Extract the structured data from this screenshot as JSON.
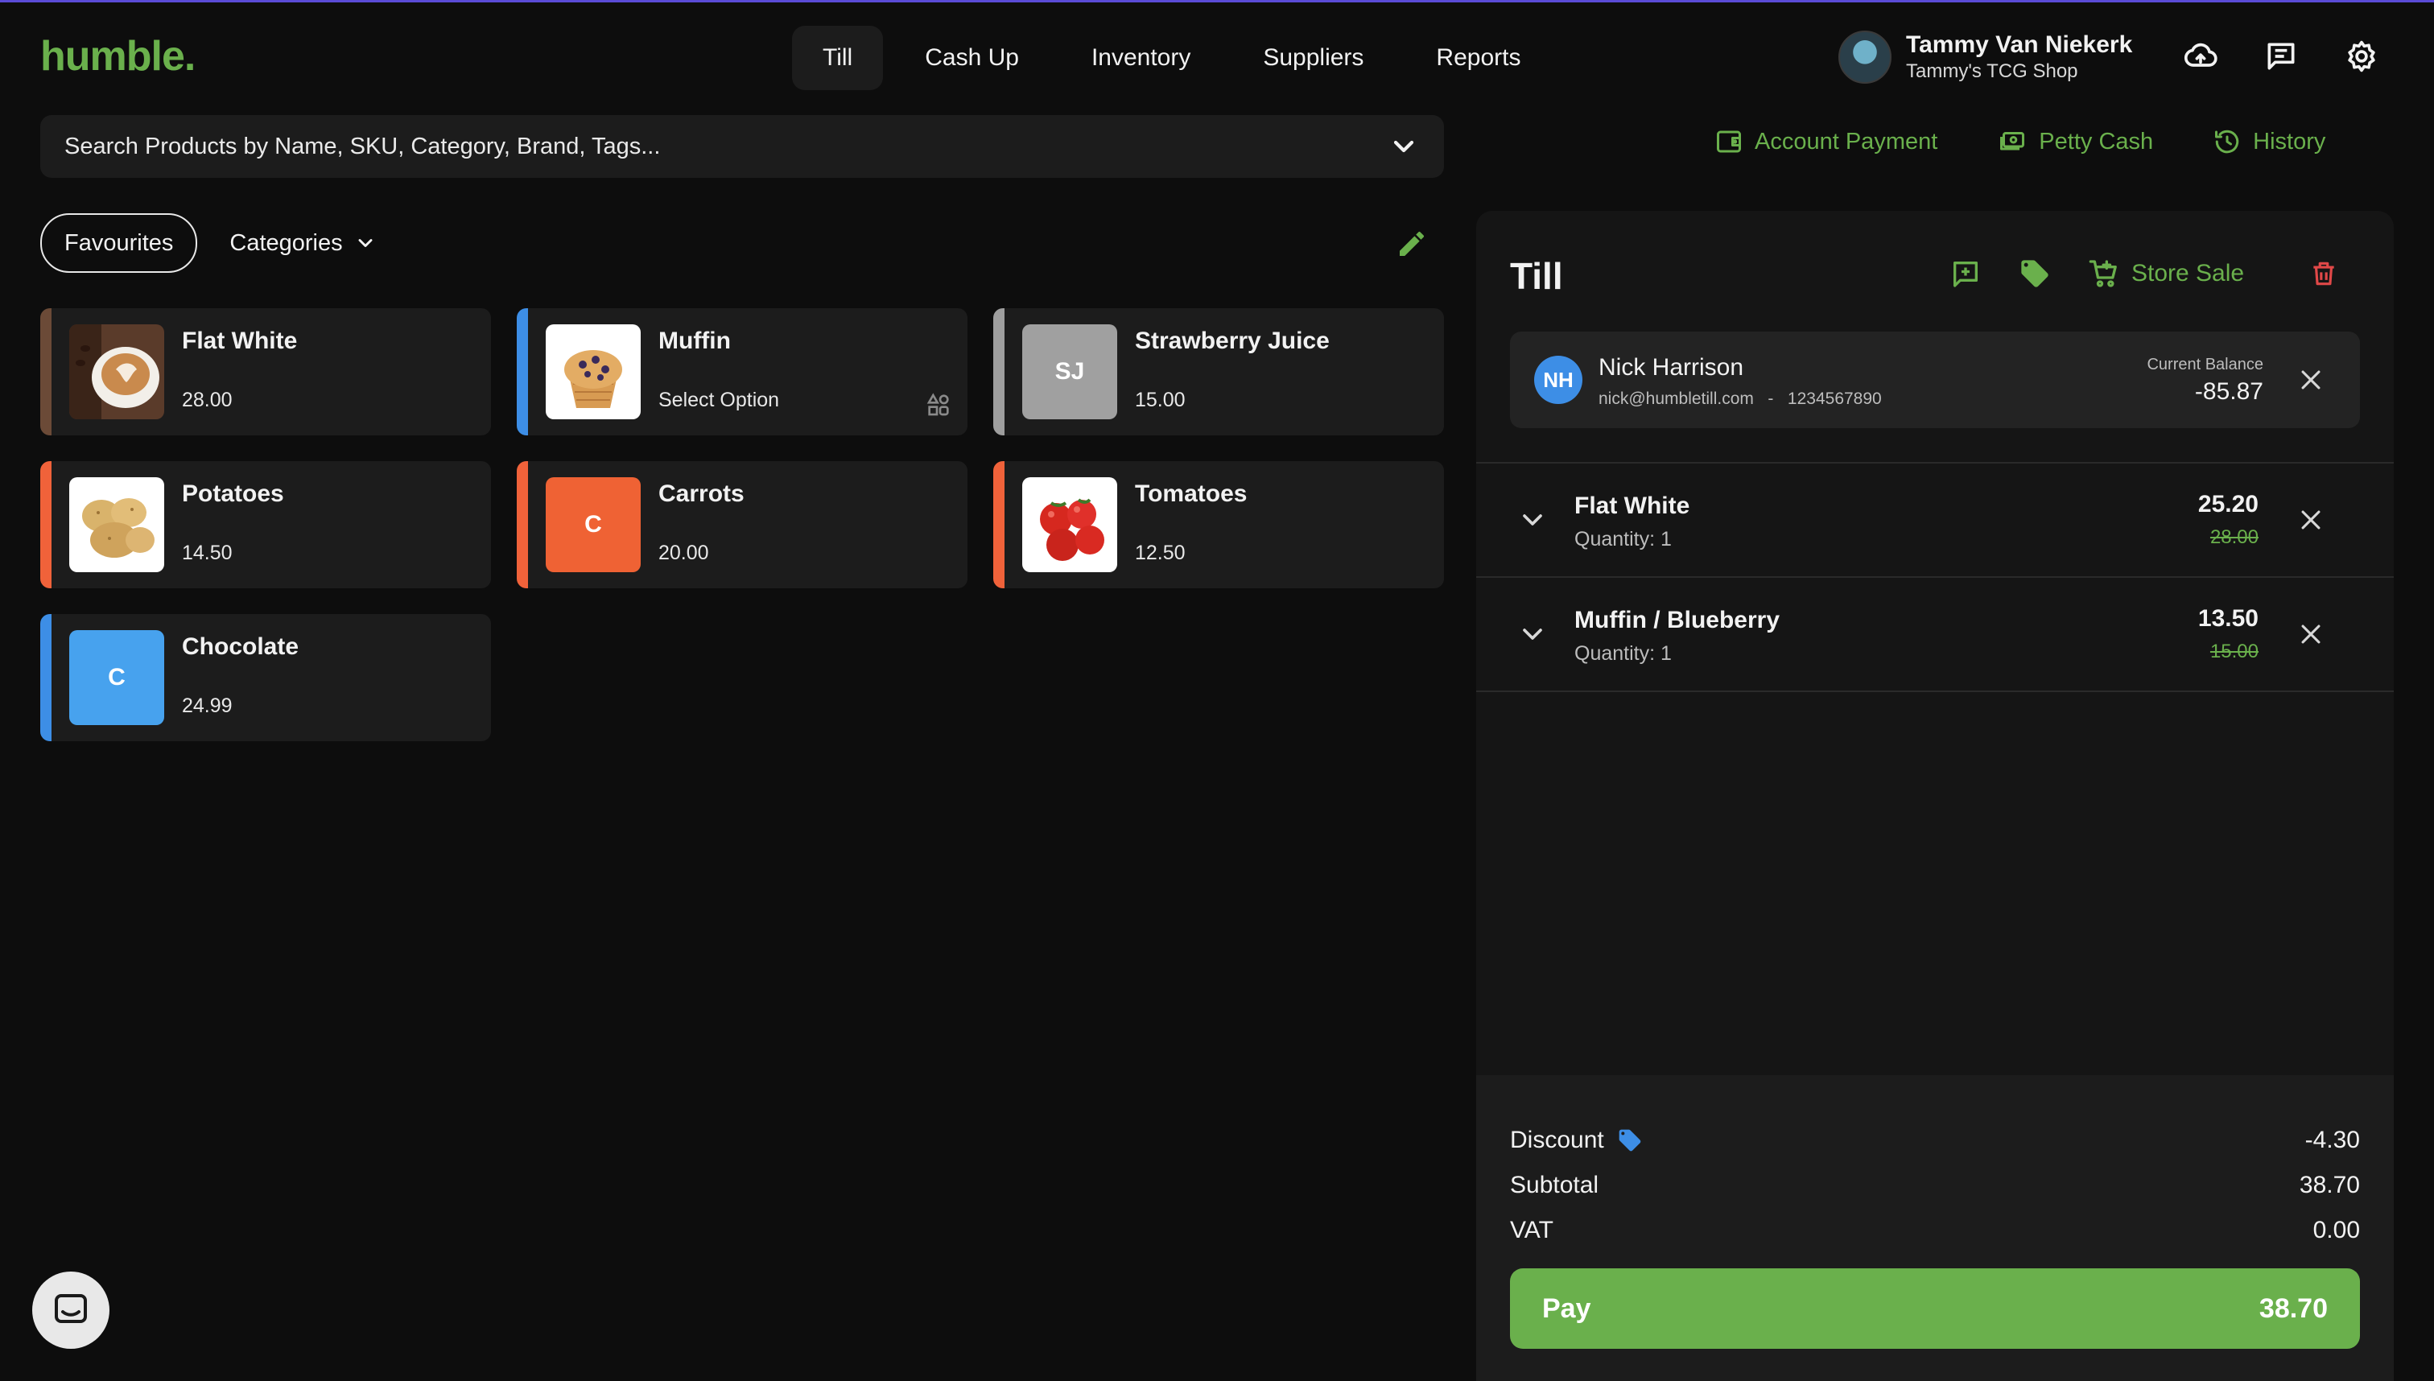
{
  "app": {
    "logo": "humble.",
    "accent": "#6ab04c",
    "danger": "#e04848"
  },
  "nav": {
    "tabs": [
      "Till",
      "Cash Up",
      "Inventory",
      "Suppliers",
      "Reports"
    ],
    "active": "Till"
  },
  "user": {
    "name": "Tammy Van Niekerk",
    "shop": "Tammy's TCG Shop"
  },
  "search": {
    "placeholder": "Search Products by Name, SKU, Category, Brand, Tags..."
  },
  "actions": {
    "account_payment": "Account Payment",
    "petty_cash": "Petty Cash",
    "history": "History"
  },
  "filters": {
    "favourites": "Favourites",
    "categories": "Categories"
  },
  "products": [
    {
      "name": "Flat White",
      "price": "28.00",
      "stripe": "#6b4a37",
      "thumb": "coffee"
    },
    {
      "name": "Muffin",
      "price": "Select Option",
      "stripe": "#3d8ee6",
      "thumb": "muffin",
      "variants": true
    },
    {
      "name": "Strawberry Juice",
      "price": "15.00",
      "stripe": "#9e9e9e",
      "thumb": "initials",
      "initials": "SJ",
      "thumb_color": "#a0a0a0"
    },
    {
      "name": "Potatoes",
      "price": "14.50",
      "stripe": "#f0623a",
      "thumb": "potatoes"
    },
    {
      "name": "Carrots",
      "price": "20.00",
      "stripe": "#f0623a",
      "thumb": "initials",
      "initials": "C",
      "thumb_color": "#ef6234"
    },
    {
      "name": "Tomatoes",
      "price": "12.50",
      "stripe": "#f0623a",
      "thumb": "tomatoes"
    },
    {
      "name": "Chocolate",
      "price": "24.99",
      "stripe": "#3d8ee6",
      "thumb": "initials",
      "initials": "C",
      "thumb_color": "#47a2ee"
    }
  ],
  "till": {
    "title": "Till",
    "store_sale": "Store Sale",
    "customer": {
      "initials": "NH",
      "name": "Nick Harrison",
      "email": "nick@humbletill.com",
      "phone": "1234567890",
      "balance_label": "Current Balance",
      "balance": "-85.87"
    },
    "items": [
      {
        "name": "Flat White",
        "qty": "Quantity: 1",
        "price": "25.20",
        "original": "28.00"
      },
      {
        "name": "Muffin / Blueberry",
        "qty": "Quantity: 1",
        "price": "13.50",
        "original": "15.00"
      }
    ],
    "totals": {
      "discount_label": "Discount",
      "discount": "-4.30",
      "subtotal_label": "Subtotal",
      "subtotal": "38.70",
      "vat_label": "VAT",
      "vat": "0.00"
    },
    "pay_label": "Pay",
    "pay_amount": "38.70"
  }
}
